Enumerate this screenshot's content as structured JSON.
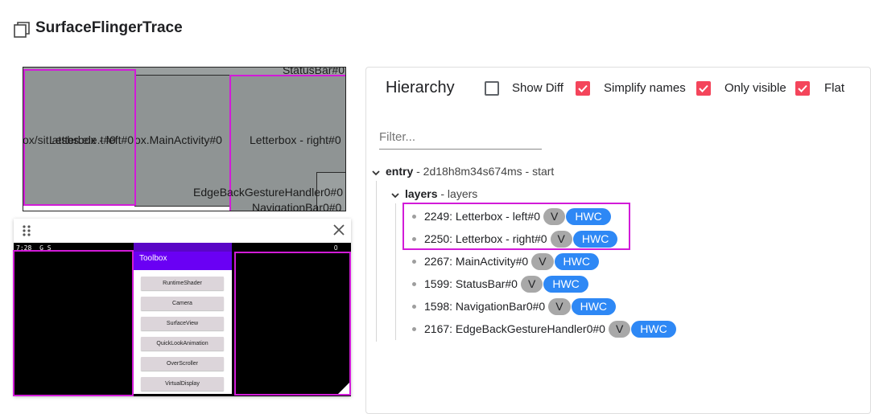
{
  "header": {
    "title": "SurfaceFlingerTrace",
    "icon": "copy-icon"
  },
  "rects_view": {
    "labels": {
      "status_bar": "StatusBar#0",
      "left": "Letterbox - left#0",
      "left_overlap": "ox/sit.atsbs.ele.t#0",
      "main": "ox.MainActivity#0",
      "right": "Letterbox - right#0",
      "edge": "EdgeBackGestureHandler0#0",
      "navbar": "NavigationBar0#0"
    }
  },
  "mirror": {
    "status_time": "7:28",
    "status_icons": "G  S",
    "status_right": "0",
    "app_title": "Toolbox",
    "buttons": [
      "RuntimeShader",
      "Camera",
      "SurfaceView",
      "QuickLookAnimation",
      "OverScroller",
      "VirtualDisplay"
    ],
    "drag_icon": "drag-handle-icon",
    "close_icon": "close-icon"
  },
  "hierarchy": {
    "title": "Hierarchy",
    "options": [
      {
        "label": "Show Diff",
        "checked": false
      },
      {
        "label": "Simplify names",
        "checked": true
      },
      {
        "label": "Only visible",
        "checked": true
      },
      {
        "label": "Flat",
        "checked": true
      }
    ],
    "filter_placeholder": "Filter...",
    "entry": {
      "name": "entry",
      "desc": " - 2d18h8m34s674ms - start"
    },
    "layers": {
      "name": "layers",
      "desc": " - layers"
    },
    "items": [
      {
        "label": "2249: Letterbox - left#0",
        "v": "V",
        "hwc": "HWC"
      },
      {
        "label": "2250: Letterbox - right#0",
        "v": "V",
        "hwc": "HWC"
      },
      {
        "label": "2267: MainActivity#0",
        "v": "V",
        "hwc": "HWC"
      },
      {
        "label": "1599: StatusBar#0",
        "v": "V",
        "hwc": "HWC"
      },
      {
        "label": "1598: NavigationBar0#0",
        "v": "V",
        "hwc": "HWC"
      },
      {
        "label": "2167: EdgeBackGestureHandler0#0",
        "v": "V",
        "hwc": "HWC"
      }
    ]
  },
  "colors": {
    "selection": "#d21bd8",
    "checkbox_on": "#f4455b",
    "hwc_chip": "#2e88f5",
    "v_chip": "#a8a8a8"
  }
}
